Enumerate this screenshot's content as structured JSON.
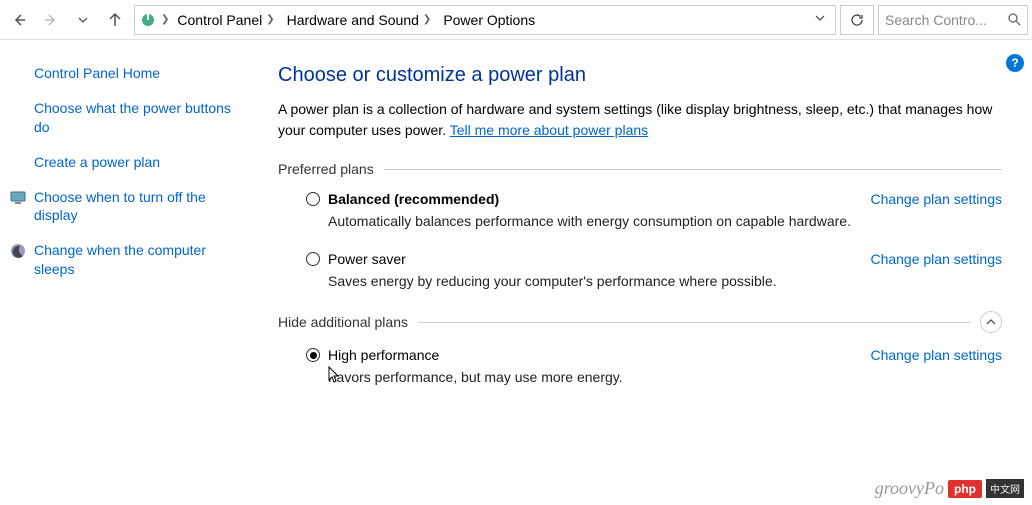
{
  "toolbar": {
    "breadcrumbs": [
      "Control Panel",
      "Hardware and Sound",
      "Power Options"
    ],
    "search_placeholder": "Search Contro..."
  },
  "sidebar": {
    "items": [
      {
        "label": "Control Panel Home",
        "icon": null
      },
      {
        "label": "Choose what the power buttons do",
        "icon": null
      },
      {
        "label": "Create a power plan",
        "icon": null
      },
      {
        "label": "Choose when to turn off the display",
        "icon": "monitor"
      },
      {
        "label": "Change when the computer sleeps",
        "icon": "moon"
      }
    ]
  },
  "main": {
    "heading": "Choose or customize a power plan",
    "description": "A power plan is a collection of hardware and system settings (like display brightness, sleep, etc.) that manages how your computer uses power. ",
    "learn_more": "Tell me more about power plans",
    "section_preferred": "Preferred plans",
    "section_additional": "Hide additional plans",
    "change_link": "Change plan settings",
    "plans_preferred": [
      {
        "name": "Balanced (recommended)",
        "bold": true,
        "selected": false,
        "desc": "Automatically balances performance with energy consumption on capable hardware."
      },
      {
        "name": "Power saver",
        "bold": false,
        "selected": false,
        "desc": "Saves energy by reducing your computer's performance where possible."
      }
    ],
    "plans_additional": [
      {
        "name": "High performance",
        "bold": false,
        "selected": true,
        "desc": "Favors performance, but may use more energy."
      }
    ]
  },
  "watermark": {
    "text": "groovyPo",
    "badge1": "php",
    "badge2": "中文网"
  }
}
